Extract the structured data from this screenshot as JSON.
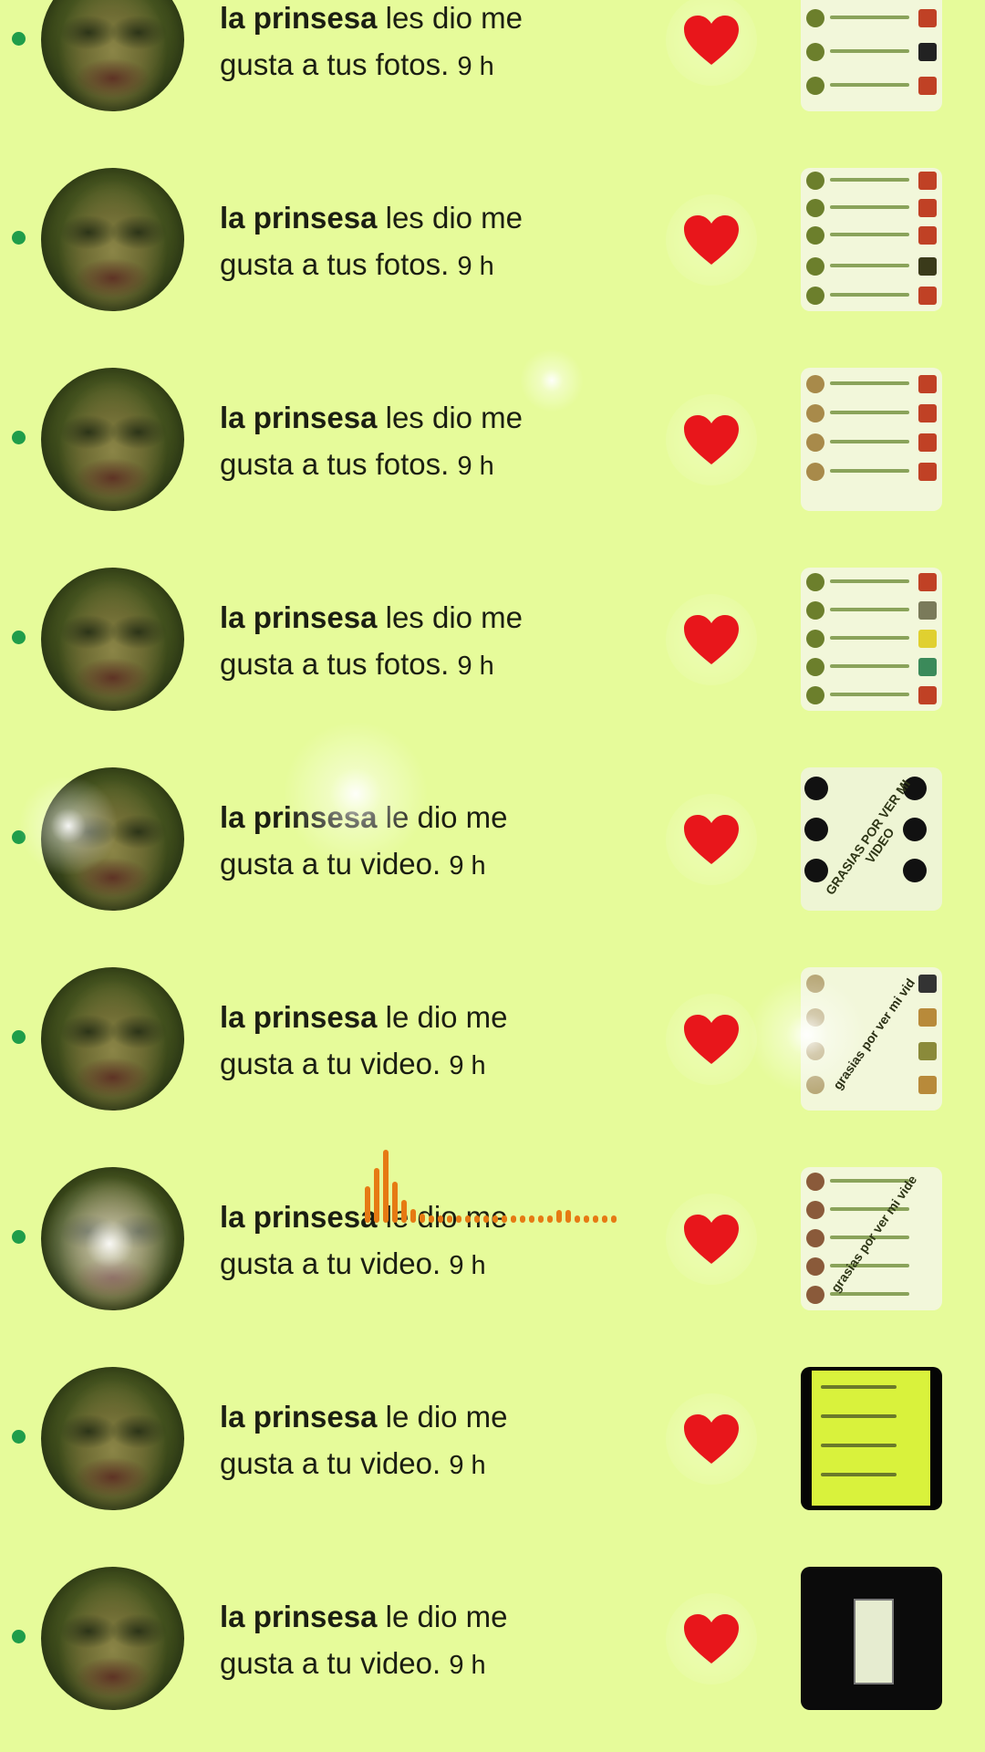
{
  "notifications": [
    {
      "name": "la prinsesa",
      "action": "les dio me gusta a tus fotos.",
      "time": "9 h"
    },
    {
      "name": "la prinsesa",
      "action": "les dio me gusta a tus fotos.",
      "time": "9 h"
    },
    {
      "name": "la prinsesa",
      "action": "les dio me gusta a tus fotos.",
      "time": "9 h"
    },
    {
      "name": "la prinsesa",
      "action": "les dio me gusta a tus fotos.",
      "time": "9 h"
    },
    {
      "name": "la prinsesa",
      "action": "le dio me gusta a tu video.",
      "time": "9 h"
    },
    {
      "name": "la prinsesa",
      "action": "le dio me gusta a tu video.",
      "time": "9 h"
    },
    {
      "name": "la prinsesa",
      "action": "le dio me gusta a tu video.",
      "time": "9 h"
    },
    {
      "name": "la prinsesa",
      "action": "le dio me gusta a tu video.",
      "time": "9 h"
    },
    {
      "name": "la prinsesa",
      "action": "le dio me gusta a tu video.",
      "time": "9 h"
    }
  ],
  "thumb_captions": {
    "row5": "GRASIAS POR VER MI VIDEO",
    "row6": "grasias por ver mi vid",
    "row7": "grasias por ver mi vide"
  },
  "colors": {
    "background": "#e6fb9a",
    "unread_dot": "#1f9d4a",
    "heart": "#e8161b",
    "audio_wave": "#e67a13"
  },
  "icons": {
    "like": "heart-icon",
    "unread": "unread-dot-icon"
  }
}
